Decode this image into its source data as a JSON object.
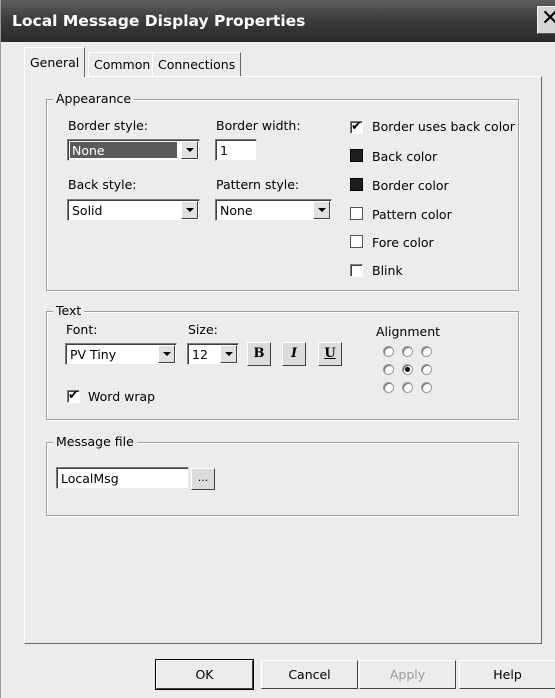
{
  "window": {
    "title": "Local Message Display Properties",
    "close_glyph": "✕"
  },
  "tabs": [
    {
      "label": "General",
      "active": true
    },
    {
      "label": "Common",
      "active": false
    },
    {
      "label": "Connections",
      "active": false
    }
  ],
  "appearance": {
    "legend": "Appearance",
    "border_style": {
      "label": "Border style:",
      "value": "None"
    },
    "border_width": {
      "label": "Border width:",
      "value": "1"
    },
    "back_style": {
      "label": "Back style:",
      "value": "Solid"
    },
    "pattern_style": {
      "label": "Pattern style:",
      "value": "None"
    },
    "border_uses_back_color": {
      "label": "Border uses back color",
      "checked": true
    },
    "back_color": {
      "label": "Back color",
      "swatch": "#1e1e1e"
    },
    "border_color": {
      "label": "Border color",
      "swatch": "#1e1e1e"
    },
    "pattern_color": {
      "label": "Pattern color",
      "swatch": "#ffffff"
    },
    "fore_color": {
      "label": "Fore color",
      "swatch": "#ffffff"
    },
    "blink": {
      "label": "Blink",
      "checked": false
    }
  },
  "text": {
    "legend": "Text",
    "font": {
      "label": "Font:",
      "value": "PV Tiny"
    },
    "size": {
      "label": "Size:",
      "value": "12"
    },
    "bold_label": "B",
    "italic_label": "I",
    "underline_label": "U",
    "alignment": {
      "label": "Alignment",
      "selected": "middle-center"
    },
    "word_wrap": {
      "label": "Word wrap",
      "checked": true
    }
  },
  "message_file": {
    "legend": "Message file",
    "value": "LocalMsg",
    "browse_label": "..."
  },
  "buttons": {
    "ok": "OK",
    "cancel": "Cancel",
    "apply": "Apply",
    "help": "Help"
  },
  "check_glyph": "✔"
}
